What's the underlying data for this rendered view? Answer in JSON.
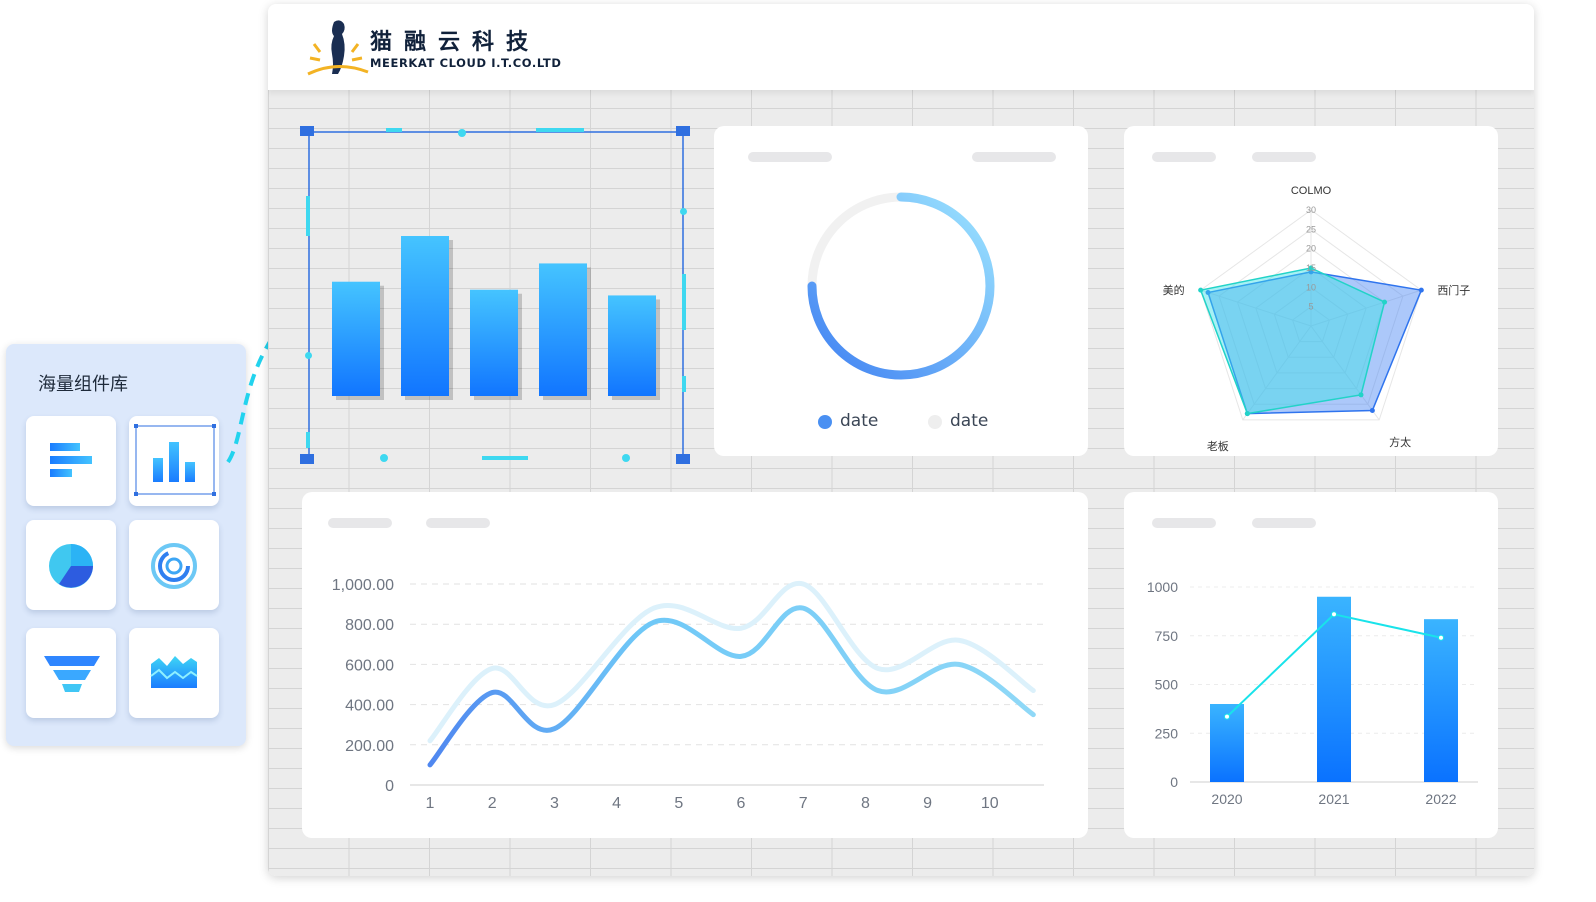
{
  "header": {
    "brand_cn": "猫融云科技",
    "brand_en": "MEERKAT CLOUD I.T.CO.LTD",
    "logo_icon": "meerkat-logo-icon"
  },
  "component_panel": {
    "title": "海量组件库",
    "items": [
      {
        "icon": "horizontal-bar-chart-icon"
      },
      {
        "icon": "column-chart-icon",
        "selected": true
      },
      {
        "icon": "pie-chart-icon"
      },
      {
        "icon": "ring-chart-icon"
      },
      {
        "icon": "funnel-chart-icon"
      },
      {
        "icon": "area-chart-icon"
      }
    ]
  },
  "colors": {
    "accent": "#1a7cff",
    "accent_light": "#43c3ff",
    "cyan": "#1fe0e6",
    "selection": "#2f6fe0",
    "grid_bg": "#ececec"
  },
  "donut": {
    "legend": [
      {
        "label": "date",
        "color": "#4a90f2"
      },
      {
        "label": "date",
        "color": "#eeeeee"
      }
    ]
  },
  "chart_data": [
    {
      "type": "bar",
      "values": [
        10,
        14,
        9.3,
        11.6,
        8.8
      ]
    },
    {
      "type": "pie",
      "values": [
        0.75,
        0.25
      ]
    },
    {
      "type": "radar",
      "axes": [
        "COLMO",
        "西门子",
        "方太",
        "老板",
        "美的"
      ],
      "radial_ticks": [
        "30",
        "25",
        "20",
        "15",
        "10",
        "5"
      ],
      "radial_range": [
        0,
        30
      ],
      "series": [
        {
          "values": [
            14,
            30,
            27,
            28,
            28
          ]
        },
        {
          "values": [
            15,
            20,
            22,
            28,
            30
          ]
        }
      ]
    },
    {
      "type": "line",
      "x": [
        1,
        2,
        3,
        4,
        5,
        6,
        7,
        8,
        9,
        10
      ],
      "x_tick_labels": [
        "1",
        "2",
        "3",
        "4",
        "5",
        "6",
        "7",
        "8",
        "9",
        "10"
      ],
      "y_tick_labels": [
        "0",
        "200.00",
        "400.00",
        "600.00",
        "800.00",
        "1,000.00"
      ],
      "ylim": [
        0,
        1000
      ],
      "series": [
        {
          "values": [
            580,
            400,
            880,
            780,
            1000,
            580,
            720,
            470
          ],
          "x": [
            2,
            3,
            4.6,
            6,
            7,
            8.2,
            9.5,
            10.7
          ]
        },
        {
          "values": [
            460,
            280,
            810,
            640,
            880,
            470,
            600,
            350
          ],
          "x": [
            2,
            3,
            4.6,
            6,
            7,
            8.2,
            9.5,
            10.7
          ]
        }
      ]
    },
    {
      "type": "bar",
      "categories": [
        "2020",
        "2021",
        "2022"
      ],
      "y_tick_labels": [
        "0",
        "250",
        "500",
        "750",
        "1000"
      ],
      "ylim": [
        0,
        1000
      ],
      "series": [
        {
          "type": "bar",
          "values": [
            400,
            950,
            835
          ]
        },
        {
          "type": "line",
          "values": [
            335,
            860,
            740
          ]
        }
      ]
    }
  ]
}
